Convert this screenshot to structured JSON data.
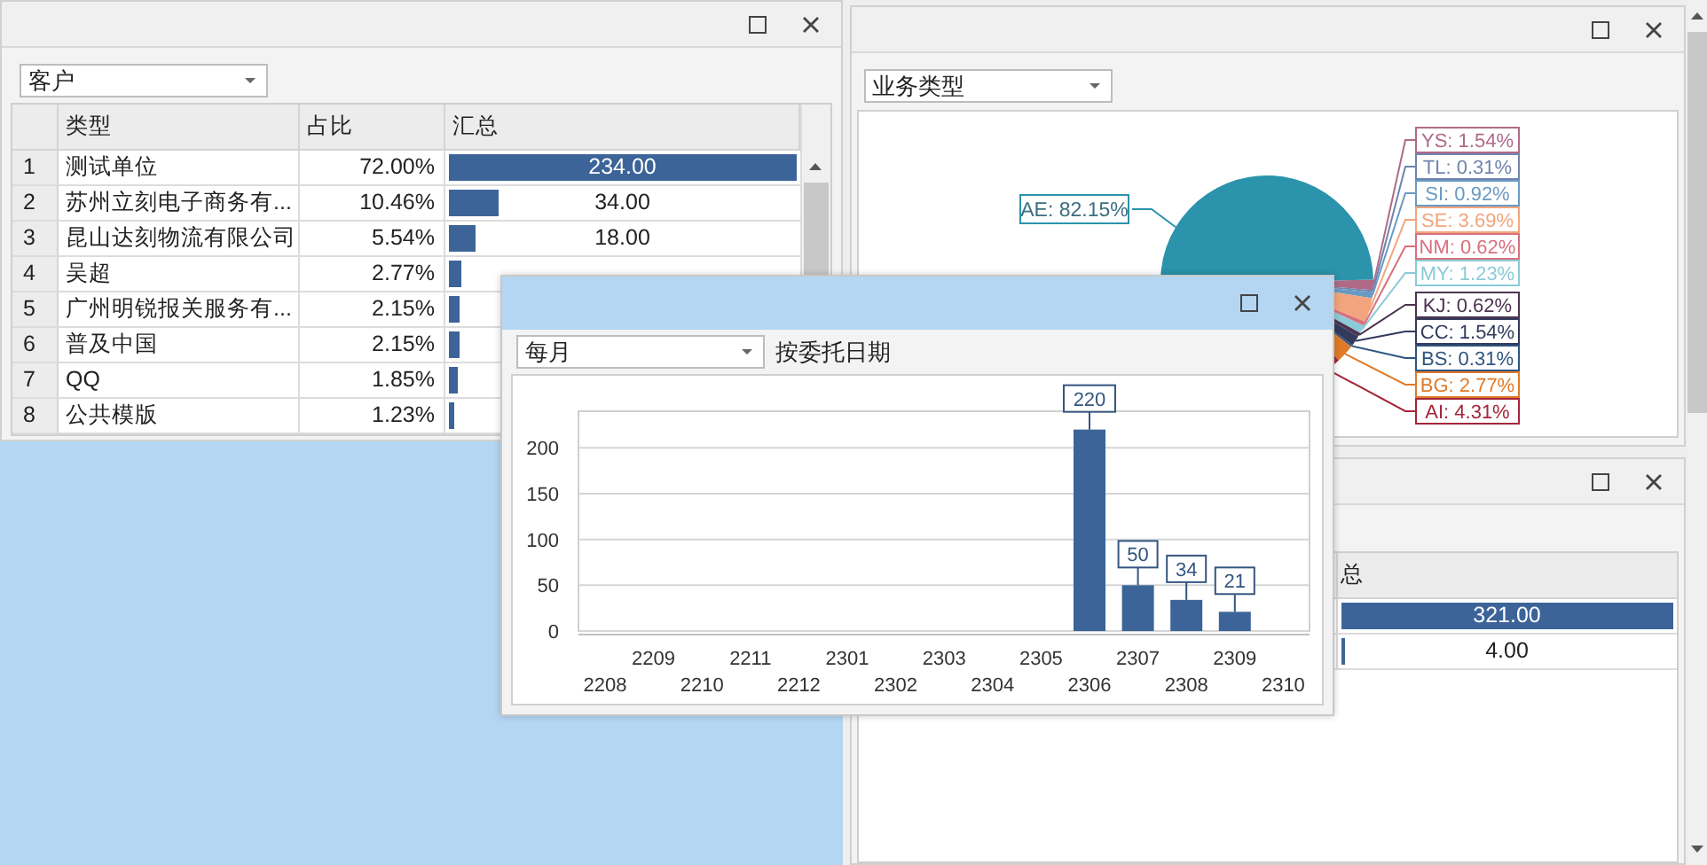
{
  "customer_panel": {
    "dropdown": "客户",
    "table": {
      "columns": [
        "类型",
        "占比",
        "汇总"
      ],
      "rows": [
        {
          "index": "1",
          "name": "测试单位",
          "share": "72.00%",
          "total": "234.00",
          "level": 1
        },
        {
          "index": "2",
          "name": "苏州立刻电子商务有...",
          "share": "10.46%",
          "total": "34.00",
          "level": 0.145
        },
        {
          "index": "3",
          "name": "昆山达刻物流有限公司",
          "share": "5.54%",
          "total": "18.00",
          "level": 0.077
        },
        {
          "index": "4",
          "name": "吴超",
          "share": "2.77%",
          "level": 0.038
        },
        {
          "index": "5",
          "name": "广州明锐报关服务有...",
          "share": "2.15%",
          "level": 0.03
        },
        {
          "index": "6",
          "name": "普及中国",
          "share": "2.15%",
          "level": 0.03
        },
        {
          "index": "7",
          "name": "QQ",
          "share": "1.85%",
          "level": 0.026
        },
        {
          "index": "8",
          "name": "公共模版",
          "share": "1.23%",
          "level": 0.017
        }
      ]
    }
  },
  "business_panel": {
    "dropdown": "业务类型",
    "chart_data": {
      "type": "pie",
      "values": [
        1.54,
        0.31,
        0.92,
        3.69,
        0.62,
        1.23,
        0.62,
        1.54,
        0.31,
        2.77,
        4.31,
        82.15
      ],
      "value_labels": [
        "YS: 1.54%",
        "TL: 0.31%",
        "SI: 0.92%",
        "SE: 3.69%",
        "NM: 0.62%",
        "MY: 1.23%",
        "KJ: 0.62%",
        "CC: 1.54%",
        "BS: 0.31%",
        "BG: 2.77%",
        "AI: 4.31%",
        "AE: 82.15%"
      ]
    }
  },
  "summary_panel": {
    "table": {
      "columns": [
        "总"
      ],
      "rows": [
        {
          "total": "321.00",
          "level": 1
        },
        {
          "total": "4.00",
          "level": 0.012
        }
      ]
    }
  },
  "monthly_dialog": {
    "dropdown": "每月",
    "label": "按委托日期",
    "chart_data": {
      "type": "bar",
      "categories": [
        "2208",
        "2209",
        "2210",
        "2211",
        "2212",
        "2301",
        "2302",
        "2303",
        "2304",
        "2305",
        "2306",
        "2307",
        "2308",
        "2309",
        "2310"
      ],
      "values": [
        null,
        null,
        null,
        null,
        null,
        null,
        null,
        null,
        null,
        null,
        220,
        50,
        34,
        21,
        null
      ],
      "value_labels": [
        null,
        null,
        null,
        null,
        null,
        null,
        null,
        null,
        null,
        null,
        "220",
        "50",
        "34",
        "21",
        null
      ],
      "ylim": [
        0,
        240
      ],
      "yticks": [
        0,
        50,
        100,
        150,
        200
      ],
      "grid": true
    }
  }
}
